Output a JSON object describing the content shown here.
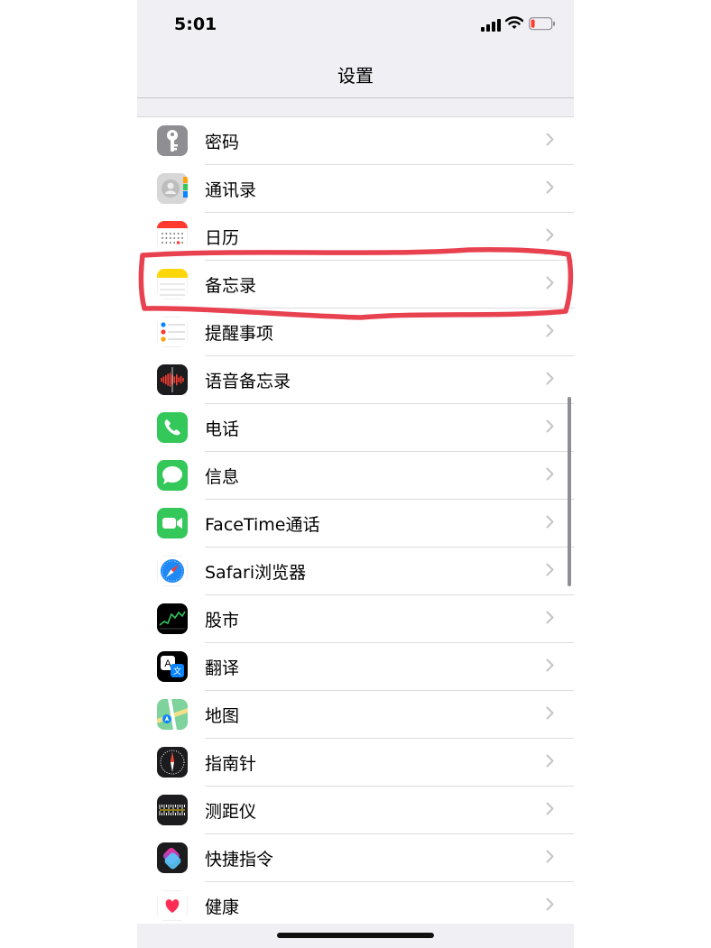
{
  "status": {
    "time": "5:01"
  },
  "nav": {
    "title": "设置"
  },
  "items": [
    {
      "label": "密码",
      "icon": "key-icon",
      "color": "#8e8e93"
    },
    {
      "label": "通讯录",
      "icon": "contacts-icon",
      "color": "#d7d7d7"
    },
    {
      "label": "日历",
      "icon": "calendar-icon",
      "color": "#ffffff"
    },
    {
      "label": "备忘录",
      "icon": "notes-icon",
      "color": "#ffd60a"
    },
    {
      "label": "提醒事项",
      "icon": "reminders-icon",
      "color": "#ffffff"
    },
    {
      "label": "语音备忘录",
      "icon": "voice-memos-icon",
      "color": "#1c1c1e"
    },
    {
      "label": "电话",
      "icon": "phone-icon",
      "color": "#34c759"
    },
    {
      "label": "信息",
      "icon": "messages-icon",
      "color": "#34c759"
    },
    {
      "label": "FaceTime通话",
      "icon": "facetime-icon",
      "color": "#34c759"
    },
    {
      "label": "Safari浏览器",
      "icon": "safari-icon",
      "color": "#1e88f5"
    },
    {
      "label": "股市",
      "icon": "stocks-icon",
      "color": "#000000"
    },
    {
      "label": "翻译",
      "icon": "translate-icon",
      "color": "#000000"
    },
    {
      "label": "地图",
      "icon": "maps-icon",
      "color": "#7ed29b"
    },
    {
      "label": "指南针",
      "icon": "compass-icon",
      "color": "#1c1c1e"
    },
    {
      "label": "测距仪",
      "icon": "measure-icon",
      "color": "#1c1c1e"
    },
    {
      "label": "快捷指令",
      "icon": "shortcuts-icon",
      "color": "#5e5ce6"
    },
    {
      "label": "健康",
      "icon": "health-icon",
      "color": "#ffffff"
    }
  ],
  "highlight": {
    "item": "备忘录",
    "color": "#e8414f"
  }
}
